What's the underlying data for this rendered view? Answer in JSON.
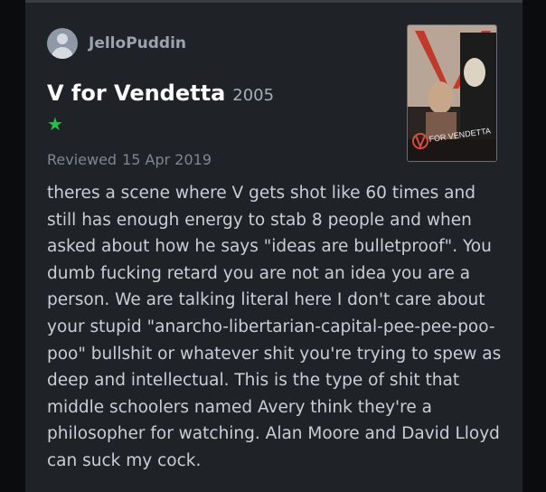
{
  "review": {
    "username": "JelloPuddin",
    "film_title": "V for Vendetta",
    "film_year": "2005",
    "rating_star": "★",
    "reviewed_label": "Reviewed",
    "reviewed_date": "15 Apr 2019",
    "poster_text": "FOR VENDETTA",
    "body": "theres a scene where V gets shot like 60 times and still has enough energy to stab 8 people and when asked about how he says \"ideas are bulletproof\". You dumb fucking retard you are not an idea you are a person. We are talking literal here I don't care about your stupid \"anarcho-libertarian-capital-pee-pee-poo-poo\" bullshit or whatever shit you're trying to spew as deep and intellectual. This is the type of shit that middle schoolers named Avery think they're a philosopher for watching. Alan Moore and David Lloyd can suck my cock."
  },
  "colors": {
    "background": "#1f2226",
    "star": "#21c14a",
    "title": "#ffffff"
  },
  "icons": {
    "avatar": "avatar-icon",
    "star": "star-icon"
  }
}
